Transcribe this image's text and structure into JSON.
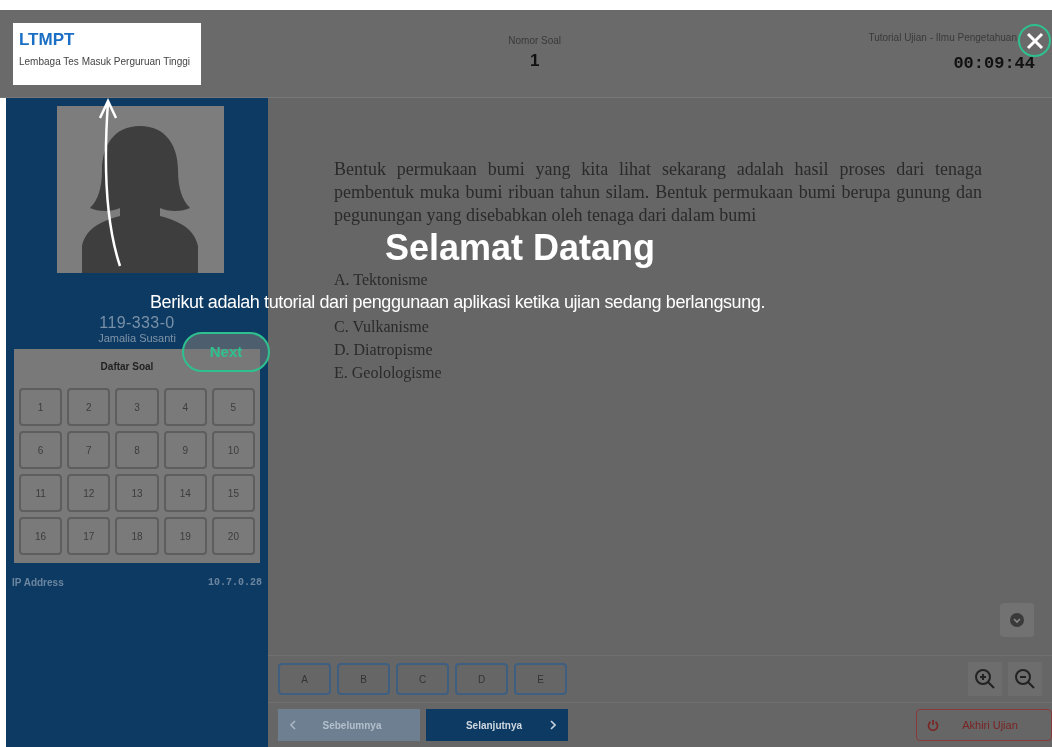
{
  "header": {
    "logo_title": "LTMPT",
    "logo_subtitle": "Lembaga Tes Masuk Perguruan Tinggi",
    "question_label": "Nomor Soal",
    "question_number": "1",
    "exam_title": "Tutorial Ujian - Ilmu Pengetahuan",
    "timer": "00:09:44"
  },
  "sidebar": {
    "participant_id": "119-333-0",
    "participant_name": "Jamalia Susanti",
    "grid_title": "Daftar Soal",
    "questions": [
      "1",
      "2",
      "3",
      "4",
      "5",
      "6",
      "7",
      "8",
      "9",
      "10",
      "11",
      "12",
      "13",
      "14",
      "15",
      "16",
      "17",
      "18",
      "19",
      "20"
    ],
    "ip_label": "IP Address",
    "ip_value": "10.7.0.28"
  },
  "question": {
    "text": "Bentuk permukaan bumi yang kita lihat sekarang adalah hasil proses dari tenaga pembentuk muka bumi ribuan tahun silam. Bentuk permukaan bumi berupa gunung dan pegunungan yang disebabkan oleh tenaga dari dalam bumi",
    "options": [
      "A. Tektonisme",
      "C. Vulkanisme",
      "D. Diatropisme",
      "E. Geolologisme"
    ]
  },
  "answers": [
    "A",
    "B",
    "C",
    "D",
    "E"
  ],
  "nav": {
    "previous": {
      "label": "Sebelumnya",
      "disabled": true
    },
    "next": {
      "label": "Selanjutnya",
      "disabled": false
    },
    "end": "Akhiri Ujian"
  },
  "tutorial": {
    "title": "Selamat Datang",
    "text": "Berikut adalah tutorial dari penggunaan aplikasi ketika ujian sedang berlangsung.",
    "next": "Next"
  }
}
